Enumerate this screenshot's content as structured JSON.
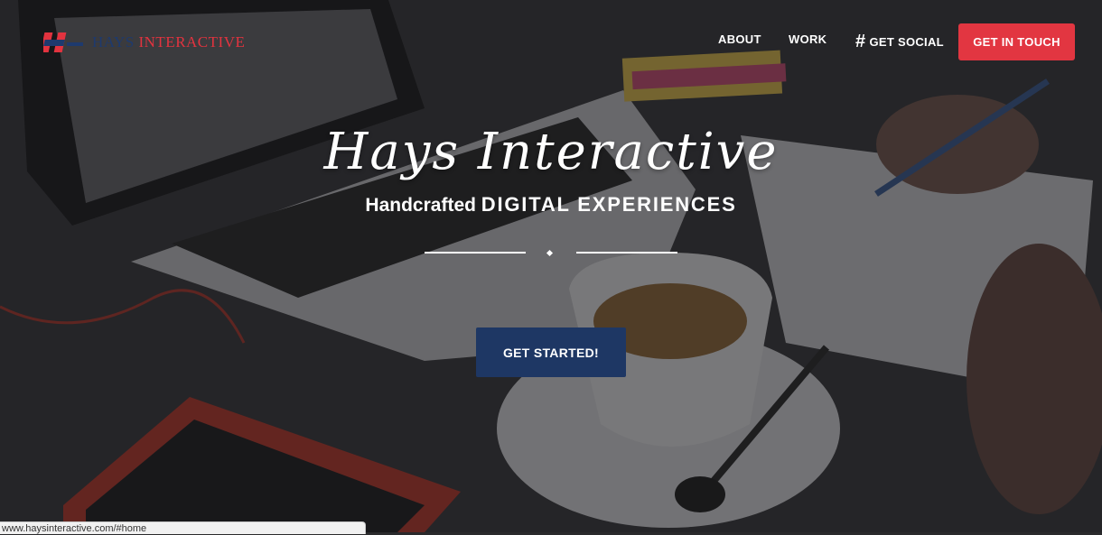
{
  "logo": {
    "part1": "HAYS",
    "part2": "INTERACTIVE"
  },
  "nav": {
    "about": "ABOUT",
    "work": "WORK",
    "social_icon": "#",
    "social": "GET SOCIAL",
    "get_in_touch": "GET IN TOUCH"
  },
  "hero": {
    "title": "Hays Interactive",
    "tagline_prefix": "Handcrafted",
    "tagline_main": "DIGITAL EXPERIENCES",
    "cta": "GET STARTED!"
  },
  "status_bar": {
    "url": "www.haysinteractive.com/#home"
  },
  "colors": {
    "accent_red": "#e23641",
    "navy": "#1e3764"
  }
}
